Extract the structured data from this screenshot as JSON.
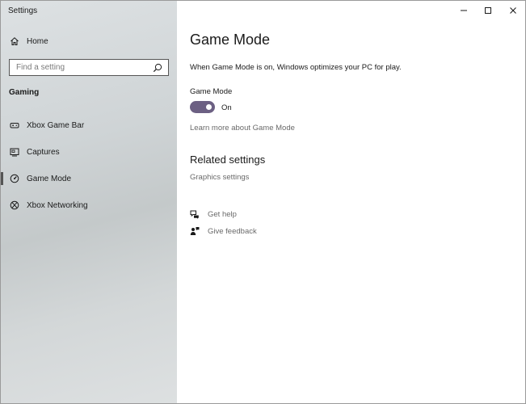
{
  "window": {
    "title": "Settings",
    "controls": [
      "minimize-icon",
      "maximize-icon",
      "close-icon"
    ]
  },
  "sidebar": {
    "home_label": "Home",
    "search": {
      "placeholder": "Find a setting",
      "value": ""
    },
    "section_label": "Gaming",
    "items": [
      {
        "label": "Xbox Game Bar",
        "icon": "xbox-game-bar-icon",
        "active": false
      },
      {
        "label": "Captures",
        "icon": "captures-icon",
        "active": false
      },
      {
        "label": "Game Mode",
        "icon": "game-mode-icon",
        "active": true
      },
      {
        "label": "Xbox Networking",
        "icon": "xbox-icon",
        "active": false
      }
    ]
  },
  "main": {
    "title": "Game Mode",
    "description": "When Game Mode is on, Windows optimizes your PC for play.",
    "setting": {
      "label": "Game Mode",
      "toggle_state": "On",
      "toggle_on": true
    },
    "learn_more_link": "Learn more about Game Mode",
    "related_title": "Related settings",
    "related_links": [
      "Graphics settings"
    ],
    "help": {
      "get_help": "Get help",
      "give_feedback": "Give feedback"
    }
  },
  "colors": {
    "accent": "#6c6083",
    "link": "#6a6a6a",
    "sidebar_bg": "#d3d7d8"
  }
}
